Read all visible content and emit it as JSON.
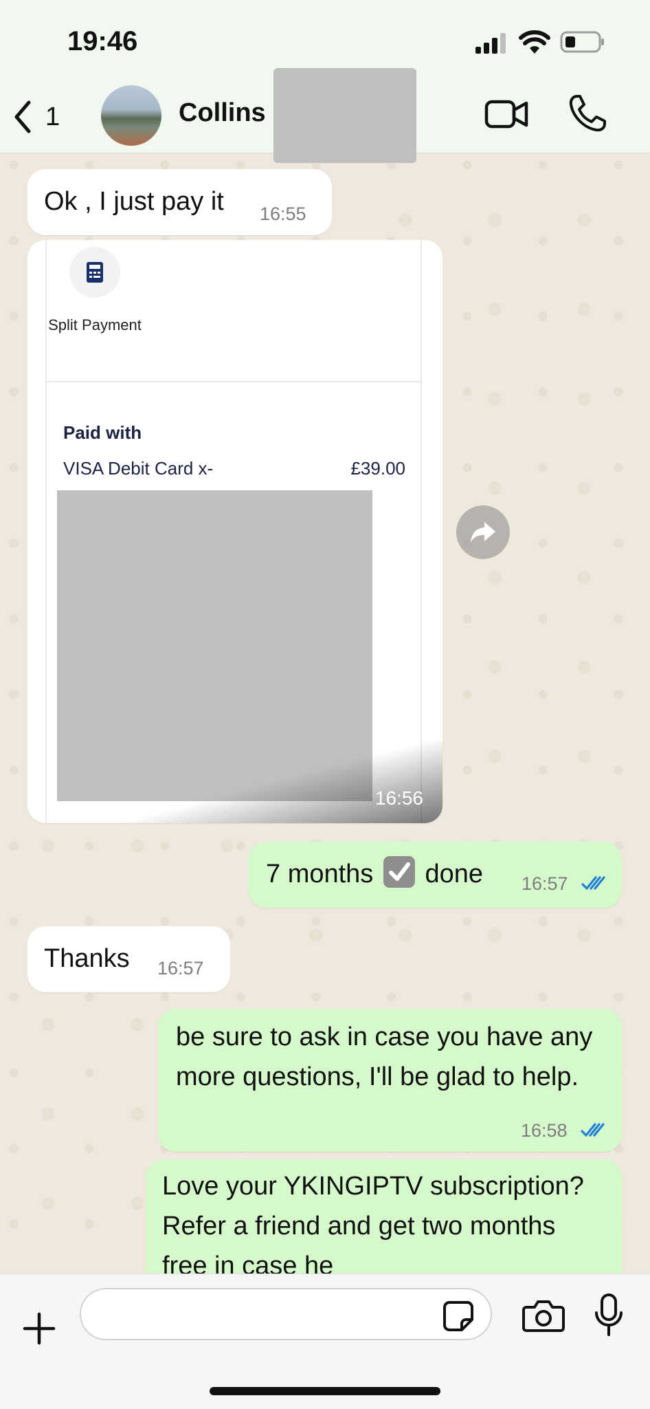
{
  "status_bar": {
    "time": "19:46"
  },
  "header": {
    "back_count": "1",
    "contact_name": "Collins I"
  },
  "messages": [
    {
      "dir": "in",
      "text": "Ok , I just pay it",
      "time": "16:55"
    },
    {
      "dir": "in",
      "type": "image",
      "time": "16:56",
      "receipt": {
        "split_label": "Split Payment",
        "paid_with": "Paid with",
        "card": "VISA Debit Card x-",
        "amount": "£39.00"
      }
    },
    {
      "dir": "out",
      "text_before": "7 months",
      "text_after": "done",
      "time": "16:57",
      "status": "read"
    },
    {
      "dir": "in",
      "text": "Thanks",
      "time": "16:57"
    },
    {
      "dir": "out",
      "text": "be sure to ask in case you have any more questions, I'll be glad to help.",
      "time": "16:58",
      "status": "read"
    },
    {
      "dir": "out",
      "text": "Love your YKINGIPTV subscription? Refer a friend and get two months free in case he"
    }
  ],
  "composer": {
    "placeholder": ""
  },
  "colors": {
    "incoming": "#ffffff",
    "outgoing": "#d6f9cc",
    "read_ticks": "#1d7fd6",
    "header_bg": "#f0f8ef"
  }
}
